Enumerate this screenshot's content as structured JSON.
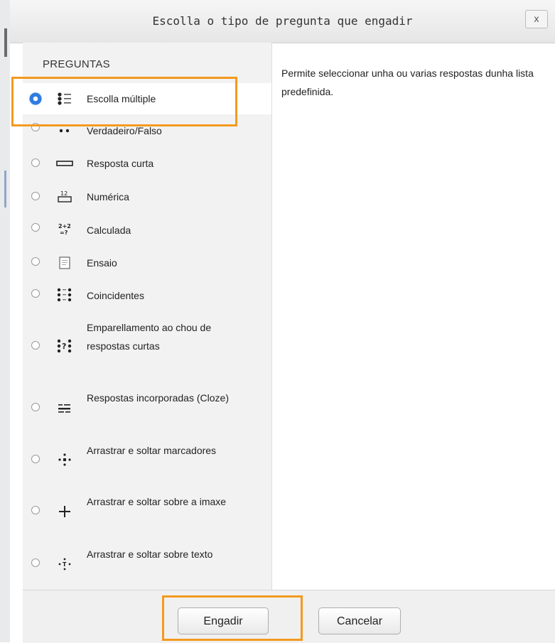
{
  "dialog": {
    "title": "Escolla o tipo de pregunta que engadir",
    "close_label": "x"
  },
  "left": {
    "heading": "PREGUNTAS",
    "items": [
      {
        "label": "Escolla múltiple",
        "icon": "multichoice-icon",
        "selected": true
      },
      {
        "label": "Verdadeiro/Falso",
        "icon": "truefalse-icon",
        "selected": false
      },
      {
        "label": "Resposta curta",
        "icon": "shortanswer-icon",
        "selected": false
      },
      {
        "label": "Numérica",
        "icon": "numerical-icon",
        "selected": false
      },
      {
        "label": "Calculada",
        "icon": "calculated-icon",
        "selected": false
      },
      {
        "label": "Ensaio",
        "icon": "essay-icon",
        "selected": false
      },
      {
        "label": "Coincidentes",
        "icon": "match-icon",
        "selected": false
      },
      {
        "label": "Emparellamento ao chou de respostas curtas",
        "icon": "randomsamatch-icon",
        "selected": false
      },
      {
        "label": "Respostas incorporadas (Cloze)",
        "icon": "multianswer-icon",
        "selected": false
      },
      {
        "label": "Arrastrar e soltar marcadores",
        "icon": "ddmarker-icon",
        "selected": false
      },
      {
        "label": "Arrastrar e soltar sobre a imaxe",
        "icon": "ddimageortext-icon",
        "selected": false
      },
      {
        "label": "Arrastrar e soltar sobre texto",
        "icon": "ddwtos-icon",
        "selected": false
      }
    ]
  },
  "right": {
    "description": "Permite seleccionar unha ou varias respostas dunha lista predefinida."
  },
  "footer": {
    "add_label": "Engadir",
    "cancel_label": "Cancelar"
  },
  "colors": {
    "highlight": "#f39a1f",
    "radio_selected": "#2e7ce0"
  }
}
